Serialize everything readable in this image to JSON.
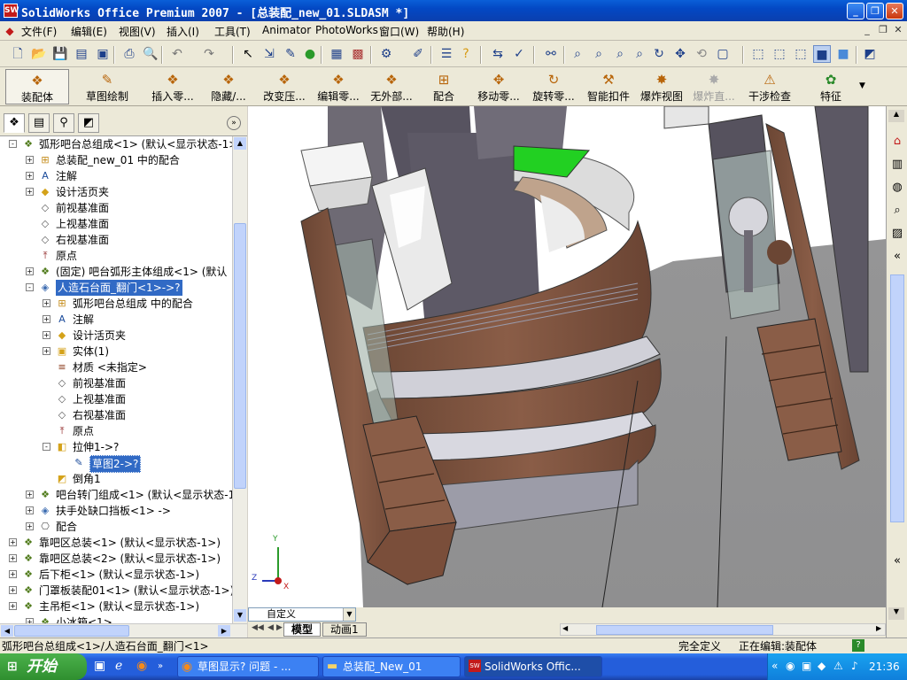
{
  "window": {
    "title": "SolidWorks Office Premium 2007 - [总装配_new_01.SLDASM *]",
    "logo_text": "SW"
  },
  "menubar": {
    "items": [
      "文件(F)",
      "编辑(E)",
      "视图(V)",
      "插入(I)",
      "工具(T)",
      "Animator",
      "PhotoWorks",
      "窗口(W)",
      "帮助(H)"
    ]
  },
  "command_manager": {
    "buttons": [
      {
        "label": "装配体",
        "icon": "assembly-icon"
      },
      {
        "label": "草图绘制",
        "icon": "sketch-icon"
      },
      {
        "label": "插入零...",
        "icon": "insert-component-icon"
      },
      {
        "label": "隐藏/...",
        "icon": "hide-show-icon"
      },
      {
        "label": "改变压...",
        "icon": "change-suppression-icon"
      },
      {
        "label": "编辑零...",
        "icon": "edit-component-icon"
      },
      {
        "label": "无外部...",
        "icon": "no-external-icon"
      },
      {
        "label": "配合",
        "icon": "mate-icon"
      },
      {
        "label": "移动零...",
        "icon": "move-component-icon"
      },
      {
        "label": "旋转零...",
        "icon": "rotate-component-icon"
      },
      {
        "label": "智能扣件",
        "icon": "smart-fasteners-icon"
      },
      {
        "label": "爆炸视图",
        "icon": "exploded-view-icon"
      },
      {
        "label": "爆炸直...",
        "icon": "explode-line-icon"
      },
      {
        "label": "干涉检查",
        "icon": "interference-check-icon"
      },
      {
        "label": "特征",
        "icon": "features-icon"
      }
    ]
  },
  "tree": {
    "rows": [
      {
        "label": "弧形吧台总组成<1> (默认<显示状态-1>",
        "icon": "assembly-icon",
        "exp": "-"
      },
      {
        "label": "总装配_new_01 中的配合",
        "icon": "mates-folder-icon",
        "exp": "+"
      },
      {
        "label": "注解",
        "icon": "annotations-icon",
        "exp": "+"
      },
      {
        "label": "设计活页夹",
        "icon": "design-binder-icon",
        "exp": "+"
      },
      {
        "label": "前视基准面",
        "icon": "plane-icon",
        "exp": ""
      },
      {
        "label": "上视基准面",
        "icon": "plane-icon",
        "exp": ""
      },
      {
        "label": "右视基准面",
        "icon": "plane-icon",
        "exp": ""
      },
      {
        "label": "原点",
        "icon": "origin-icon",
        "exp": ""
      },
      {
        "label": "(固定) 吧台弧形主体组成<1> (默认",
        "icon": "assembly-icon",
        "exp": "+"
      },
      {
        "label": "人造石台面_翻门<1>->?",
        "icon": "part-icon",
        "exp": "-"
      },
      {
        "label": "弧形吧台总组成 中的配合",
        "icon": "mates-folder-icon",
        "exp": "+"
      },
      {
        "label": "注解",
        "icon": "annotations-icon",
        "exp": "+"
      },
      {
        "label": "设计活页夹",
        "icon": "design-binder-icon",
        "exp": "+"
      },
      {
        "label": "实体(1)",
        "icon": "solid-bodies-icon",
        "exp": "+"
      },
      {
        "label": "材质 <未指定>",
        "icon": "material-icon",
        "exp": ""
      },
      {
        "label": "前视基准面",
        "icon": "plane-icon",
        "exp": ""
      },
      {
        "label": "上视基准面",
        "icon": "plane-icon",
        "exp": ""
      },
      {
        "label": "右视基准面",
        "icon": "plane-icon",
        "exp": ""
      },
      {
        "label": "原点",
        "icon": "origin-icon",
        "exp": ""
      },
      {
        "label": "拉伸1->?",
        "icon": "extrude-icon",
        "exp": "-"
      },
      {
        "label": "草图2->?",
        "icon": "sketch-icon",
        "exp": ""
      },
      {
        "label": "倒角1",
        "icon": "chamfer-icon",
        "exp": ""
      },
      {
        "label": "吧台转门组成<1> (默认<显示状态-1",
        "icon": "assembly-icon",
        "exp": "+"
      },
      {
        "label": "扶手处缺口挡板<1> ->",
        "icon": "part-icon",
        "exp": "+"
      },
      {
        "label": "配合",
        "icon": "mates-icon",
        "exp": "+"
      },
      {
        "label": "靠吧区总装<1> (默认<显示状态-1>)",
        "icon": "assembly-icon",
        "exp": "+"
      },
      {
        "label": "靠吧区总装<2> (默认<显示状态-1>)",
        "icon": "assembly-icon",
        "exp": "+"
      },
      {
        "label": "后下柜<1> (默认<显示状态-1>)",
        "icon": "assembly-icon",
        "exp": "+"
      },
      {
        "label": "门罩板装配01<1> (默认<显示状态-1>)",
        "icon": "assembly-icon",
        "exp": "+"
      },
      {
        "label": "主吊柜<1> (默认<显示状态-1>)",
        "icon": "assembly-icon",
        "exp": "+"
      },
      {
        "label": "小冰箱<1>",
        "icon": "assembly-icon",
        "exp": "+"
      }
    ]
  },
  "viewport": {
    "config_dropdown": "自定义",
    "tabs": [
      "模型",
      "动画1"
    ],
    "triad": {
      "x": "X",
      "y": "Y",
      "z": "Z"
    }
  },
  "statusbar": {
    "path": "弧形吧台总组成<1>/人造石台面_翻门<1>",
    "state": "完全定义",
    "editing": "正在编辑:装配体",
    "help": "?"
  },
  "taskbar": {
    "start": "开始",
    "tasks": [
      {
        "label": "草图显示? 问题 - ...",
        "icon": "firefox-icon"
      },
      {
        "label": "总装配_New_01",
        "icon": "folder-icon"
      },
      {
        "label": "SolidWorks Offic...",
        "icon": "solidworks-icon"
      }
    ],
    "clock": "21:36"
  }
}
